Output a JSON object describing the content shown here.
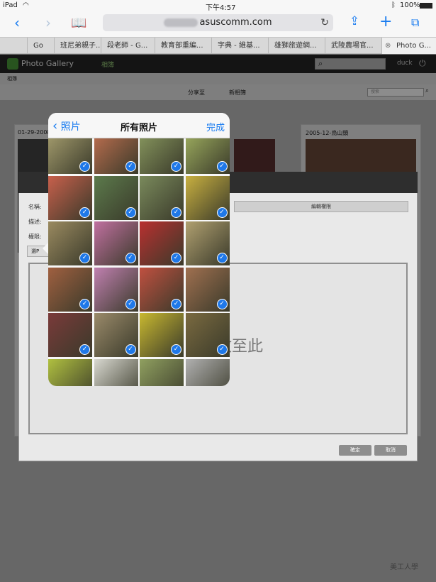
{
  "status_bar": {
    "device": "iPad",
    "time": "下午4:57",
    "battery": "100%"
  },
  "browser": {
    "url_visible": "asuscomm.com",
    "tabs": [
      "Go",
      "班尼弟親子...",
      "段老師 - G...",
      "教育部重編...",
      "字典 - 維基...",
      "雄獅旅遊網...",
      "武陵農場官...",
      "Photo G..."
    ]
  },
  "gallery": {
    "app_name": "Photo Gallery",
    "nav_active": "相簿",
    "user": "duck",
    "breadcrumb": "相簿",
    "actions": [
      "分享至",
      "新相簿"
    ],
    "filter_placeholder": "搜索",
    "albums": [
      {
        "label": "01-29-2008"
      },
      {
        "label": "2005-12-烏山頭"
      }
    ]
  },
  "dialog": {
    "name_label": "名稱:",
    "desc_label": "描述:",
    "perm_label": "權限:",
    "perm_button": "編輯權限",
    "select_button": "選P",
    "drop_text": "放至此",
    "ok_button": "確定",
    "cancel_button": "取消"
  },
  "picker": {
    "back_label": "照片",
    "title": "所有照片",
    "done_label": "完成",
    "check_mark": "✓",
    "photo_colors": [
      "#a8a070",
      "#c07050",
      "#8a9a60",
      "#a0b060",
      "#c8604c",
      "#5c7a4c",
      "#7a8a5c",
      "#c8b040",
      "#9a8a60",
      "#c070a0",
      "#b83030",
      "#b0a070",
      "#a06040",
      "#c080b0",
      "#c05040",
      "#a07050",
      "#7a3a3a",
      "#9a8a6a",
      "#c8b830",
      "#7a6a40",
      "#b0c040",
      "#d8d8d0",
      "#90a060",
      "#b0b0b0",
      "#a0a060",
      "#c0c080",
      "#706050",
      "#909090"
    ]
  },
  "watermark": "美工人學"
}
